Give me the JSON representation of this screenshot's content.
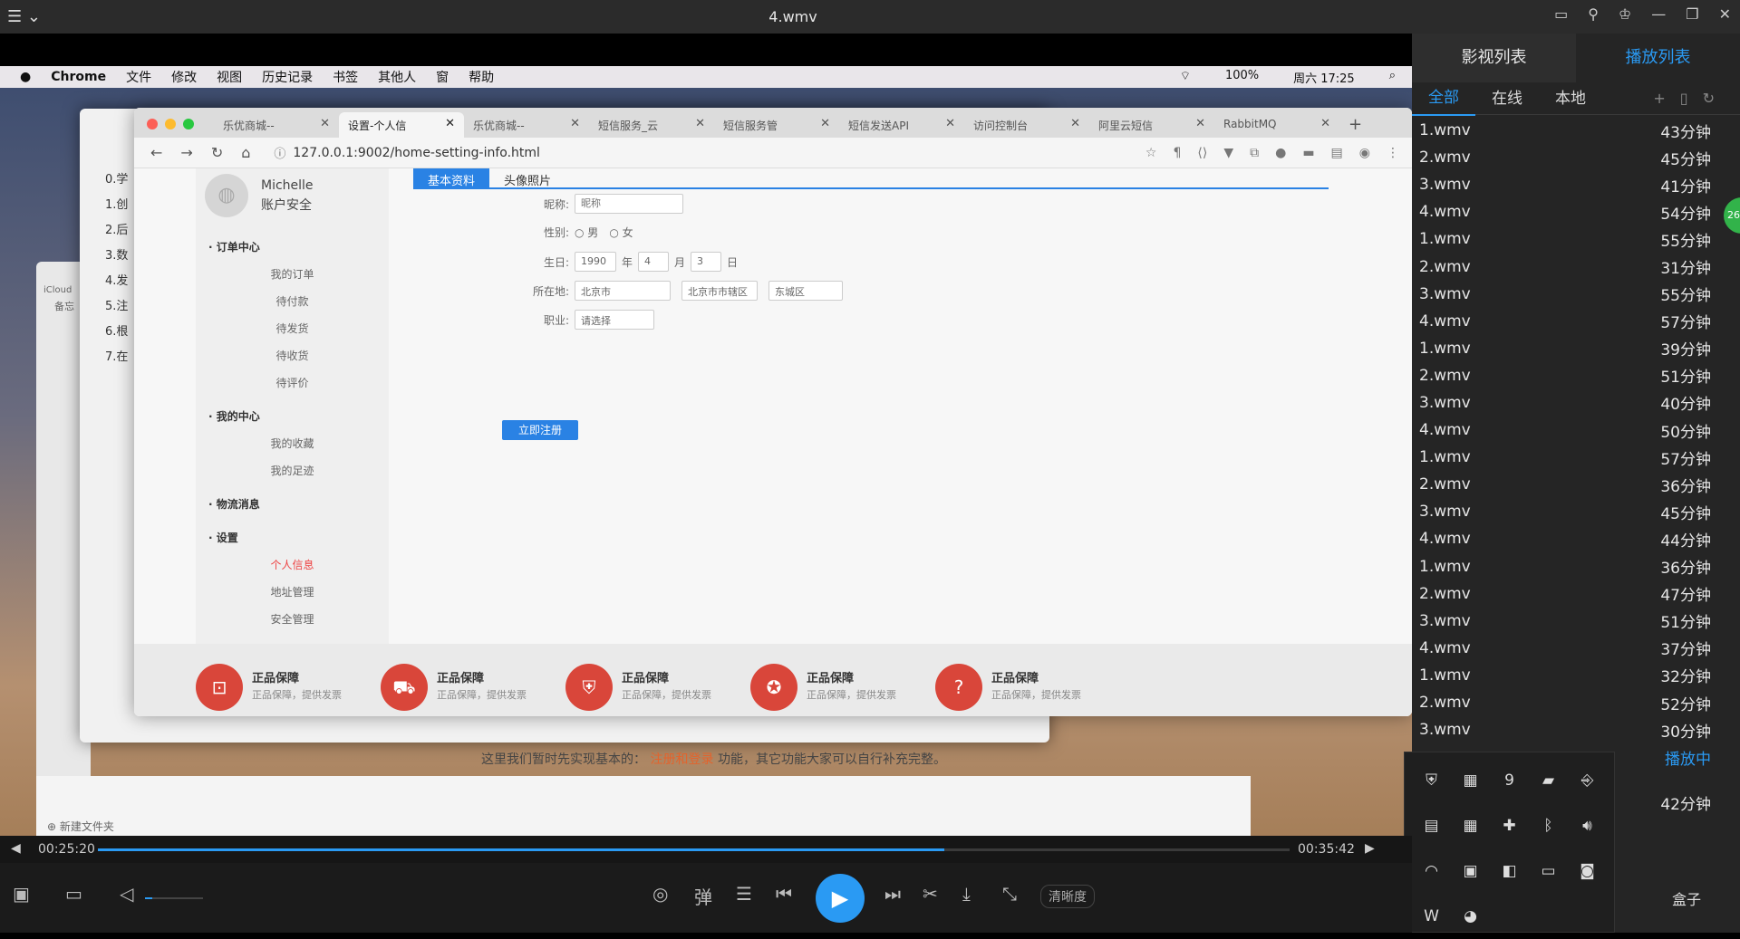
{
  "window": {
    "title": "4.wmv"
  },
  "macbar": {
    "app": "Chrome",
    "menus": [
      "文件",
      "修改",
      "视图",
      "历史记录",
      "书签",
      "其他人",
      "窗",
      "帮助"
    ],
    "battery": "100%",
    "datetime": "周六 17:25"
  },
  "back_window": {
    "items": [
      "0.学",
      "1.创",
      "2.后",
      "3.数",
      "4.发",
      "5.注",
      "6.根",
      "7.在"
    ],
    "icloud": "iCloud",
    "memo": "备忘",
    "new_folder": "新建文件夹"
  },
  "browser": {
    "tabs": [
      {
        "label": "乐优商城--"
      },
      {
        "label": "设置-个人信"
      },
      {
        "label": "乐优商城--"
      },
      {
        "label": "短信服务_云"
      },
      {
        "label": "短信服务管"
      },
      {
        "label": "短信发送API"
      },
      {
        "label": "访问控制台"
      },
      {
        "label": "阿里云短信"
      },
      {
        "label": "RabbitMQ"
      }
    ],
    "url": "127.0.0.1:9002/home-setting-info.html"
  },
  "sidebar": {
    "user_name": "Michelle",
    "user_sub": "账户安全",
    "sections": [
      {
        "title": "订单中心",
        "items": [
          "我的订单",
          "待付款",
          "待发货",
          "待收货",
          "待评价"
        ]
      },
      {
        "title": "我的中心",
        "items": [
          "我的收藏",
          "我的足迹"
        ]
      },
      {
        "title": "物流消息",
        "items": []
      },
      {
        "title": "设置",
        "items": [
          "个人信息",
          "地址管理",
          "安全管理"
        ]
      }
    ]
  },
  "form": {
    "tabs": [
      "基本资料",
      "头像照片"
    ],
    "nickname_label": "昵称:",
    "nickname_placeholder": "昵称",
    "gender_label": "性别:",
    "male": "男",
    "female": "女",
    "birthday_label": "生日:",
    "year": "1990",
    "year_unit": "年",
    "month": "4",
    "month_unit": "月",
    "day": "3",
    "day_unit": "日",
    "location_label": "所在地:",
    "province": "北京市",
    "city": "北京市市辖区",
    "district": "东城区",
    "job_label": "职业:",
    "job_placeholder": "请选择",
    "submit": "立即注册"
  },
  "footer": {
    "items": [
      {
        "title": "正品保障",
        "sub": "正品保障，提供发票"
      },
      {
        "title": "正品保障",
        "sub": "正品保障，提供发票"
      },
      {
        "title": "正品保障",
        "sub": "正品保障，提供发票"
      },
      {
        "title": "正品保障",
        "sub": "正品保障，提供发票"
      },
      {
        "title": "正品保障",
        "sub": "正品保障，提供发票"
      }
    ]
  },
  "note": {
    "pre": "这里我们暂时先实现基本的：",
    "hl": "注册和登录",
    "post": "功能，其它功能大家可以自行补充完整。"
  },
  "player": {
    "current": "00:25:20",
    "total": "00:35:42",
    "progress_fraction": 0.71,
    "danmu": "弹",
    "quality": "清晰度",
    "volume_fraction": 0.05
  },
  "panel": {
    "tab_films": "影视列表",
    "tab_playlist": "播放列表",
    "sub_all": "全部",
    "sub_online": "在线",
    "sub_local": "本地",
    "playing_label": "播放中",
    "box": "盒子",
    "badge": "26",
    "playlist": [
      {
        "name": "1.wmv",
        "dur": "43分钟"
      },
      {
        "name": "2.wmv",
        "dur": "45分钟"
      },
      {
        "name": "3.wmv",
        "dur": "41分钟"
      },
      {
        "name": "4.wmv",
        "dur": "54分钟"
      },
      {
        "name": "1.wmv",
        "dur": "55分钟"
      },
      {
        "name": "2.wmv",
        "dur": "31分钟"
      },
      {
        "name": "3.wmv",
        "dur": "55分钟"
      },
      {
        "name": "4.wmv",
        "dur": "57分钟"
      },
      {
        "name": "1.wmv",
        "dur": "39分钟"
      },
      {
        "name": "2.wmv",
        "dur": "51分钟"
      },
      {
        "name": "3.wmv",
        "dur": "40分钟"
      },
      {
        "name": "4.wmv",
        "dur": "50分钟"
      },
      {
        "name": "1.wmv",
        "dur": "57分钟"
      },
      {
        "name": "2.wmv",
        "dur": "36分钟"
      },
      {
        "name": "3.wmv",
        "dur": "45分钟"
      },
      {
        "name": "4.wmv",
        "dur": "44分钟"
      },
      {
        "name": "1.wmv",
        "dur": "36分钟"
      },
      {
        "name": "2.wmv",
        "dur": "47分钟"
      },
      {
        "name": "3.wmv",
        "dur": "51分钟"
      },
      {
        "name": "4.wmv",
        "dur": "37分钟"
      },
      {
        "name": "1.wmv",
        "dur": "32分钟"
      },
      {
        "name": "2.wmv",
        "dur": "52分钟"
      },
      {
        "name": "3.wmv",
        "dur": "30分钟"
      }
    ],
    "last_dur": "42分钟"
  },
  "tray": {
    "items": [
      "shield-icon",
      "calendar-icon",
      "nine-icon",
      "gpu-icon",
      "usb-icon",
      "doc-icon",
      "grid-icon",
      "plus-icon",
      "bluetooth-icon",
      "volume-icon",
      "wifi-icon",
      "display-icon",
      "nvidia-icon",
      "battery-icon",
      "network-icon",
      "word-icon",
      "qq-icon"
    ],
    "nine": "9"
  }
}
